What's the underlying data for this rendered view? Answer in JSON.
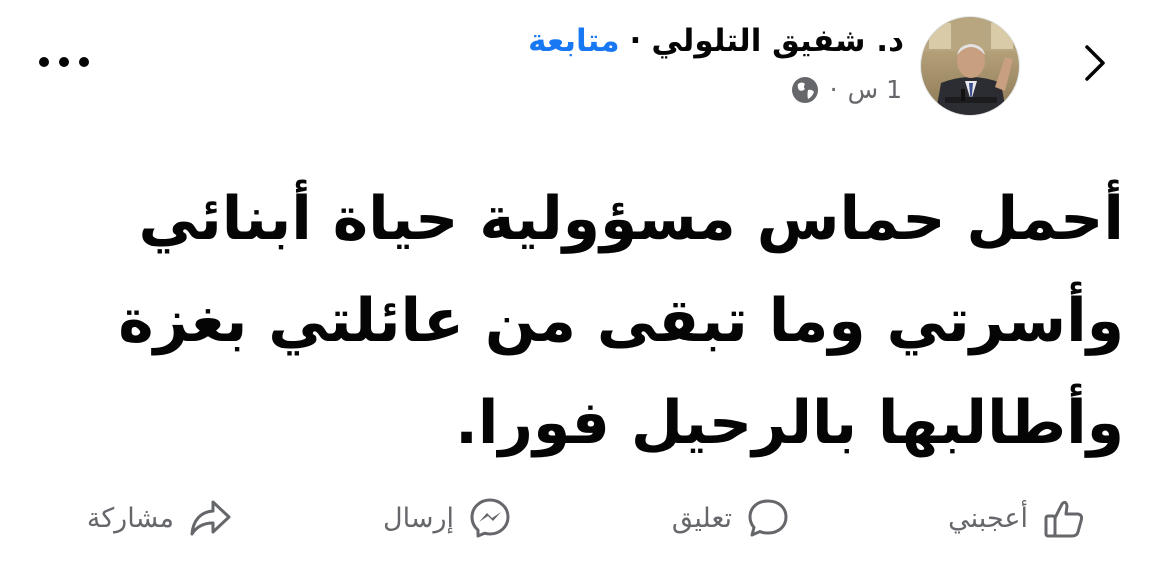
{
  "post": {
    "author_name": "د. شفيق التلولي",
    "separator": "·",
    "follow_label": "متابعة",
    "time_ago": "1 س",
    "meta_separator": "·",
    "privacy_icon": "globe-icon",
    "text_lines": [
      "أحمل حماس مسؤولية حياة أبنائي",
      "وأسرتي وما تبقى من عائلتي بغزة",
      "وأطالبها بالرحيل فورا."
    ]
  },
  "actions": {
    "like_label": "أعجبني",
    "comment_label": "تعليق",
    "send_label": "إرسال",
    "share_label": "مشاركة"
  },
  "colors": {
    "link": "#1877f2",
    "secondary_text": "#65676b",
    "primary_text": "#050505"
  }
}
